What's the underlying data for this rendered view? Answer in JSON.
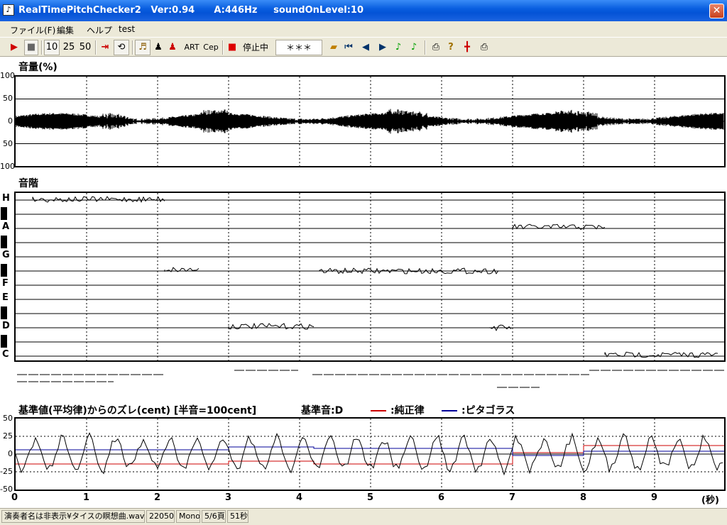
{
  "window": {
    "title": "RealTimePitchChecker2   Ver:0.94      A:446Hz     soundOnLevel:10",
    "close_label": "✕",
    "app_icon": "note-icon"
  },
  "menu": [
    {
      "label": "ファイル(F)"
    },
    {
      "label": "編集"
    },
    {
      "label": "ヘルプ"
    },
    {
      "label": "test"
    }
  ],
  "toolbar": {
    "play": "▶",
    "stop": "■",
    "speed_10": "10",
    "speed_25": "25",
    "speed_50": "50",
    "status": "停止中",
    "readout": "＊＊＊",
    "art": "ART",
    "cep": "Cep"
  },
  "volume_panel": {
    "title": "音量(%)",
    "ylabels": [
      "100",
      "50",
      "0",
      "50",
      "100"
    ]
  },
  "scale_panel": {
    "title": "音階",
    "notes": [
      "H",
      "A",
      "G",
      "F",
      "E",
      "D",
      "C"
    ]
  },
  "cent_panel": {
    "title": "基準値(平均律)からのズレ(cent) [半音=100cent]",
    "base_label": "基準音:D",
    "legend_just": ":純正律",
    "legend_pyth": ":ピタゴラス",
    "ylabels": [
      "50",
      "25",
      "0",
      "-25",
      "-50"
    ],
    "xlabels": [
      "0",
      "1",
      "2",
      "3",
      "4",
      "5",
      "6",
      "7",
      "8",
      "9"
    ],
    "xunit": "(秒)",
    "colors": {
      "just": "#cc0000",
      "pyth": "#000099"
    }
  },
  "status": {
    "file": "演奏者名は非表示¥タイスの瞑想曲.wav",
    "rate": "22050",
    "channel": "Mono",
    "page": "5/6頁",
    "length": "51秒"
  }
}
